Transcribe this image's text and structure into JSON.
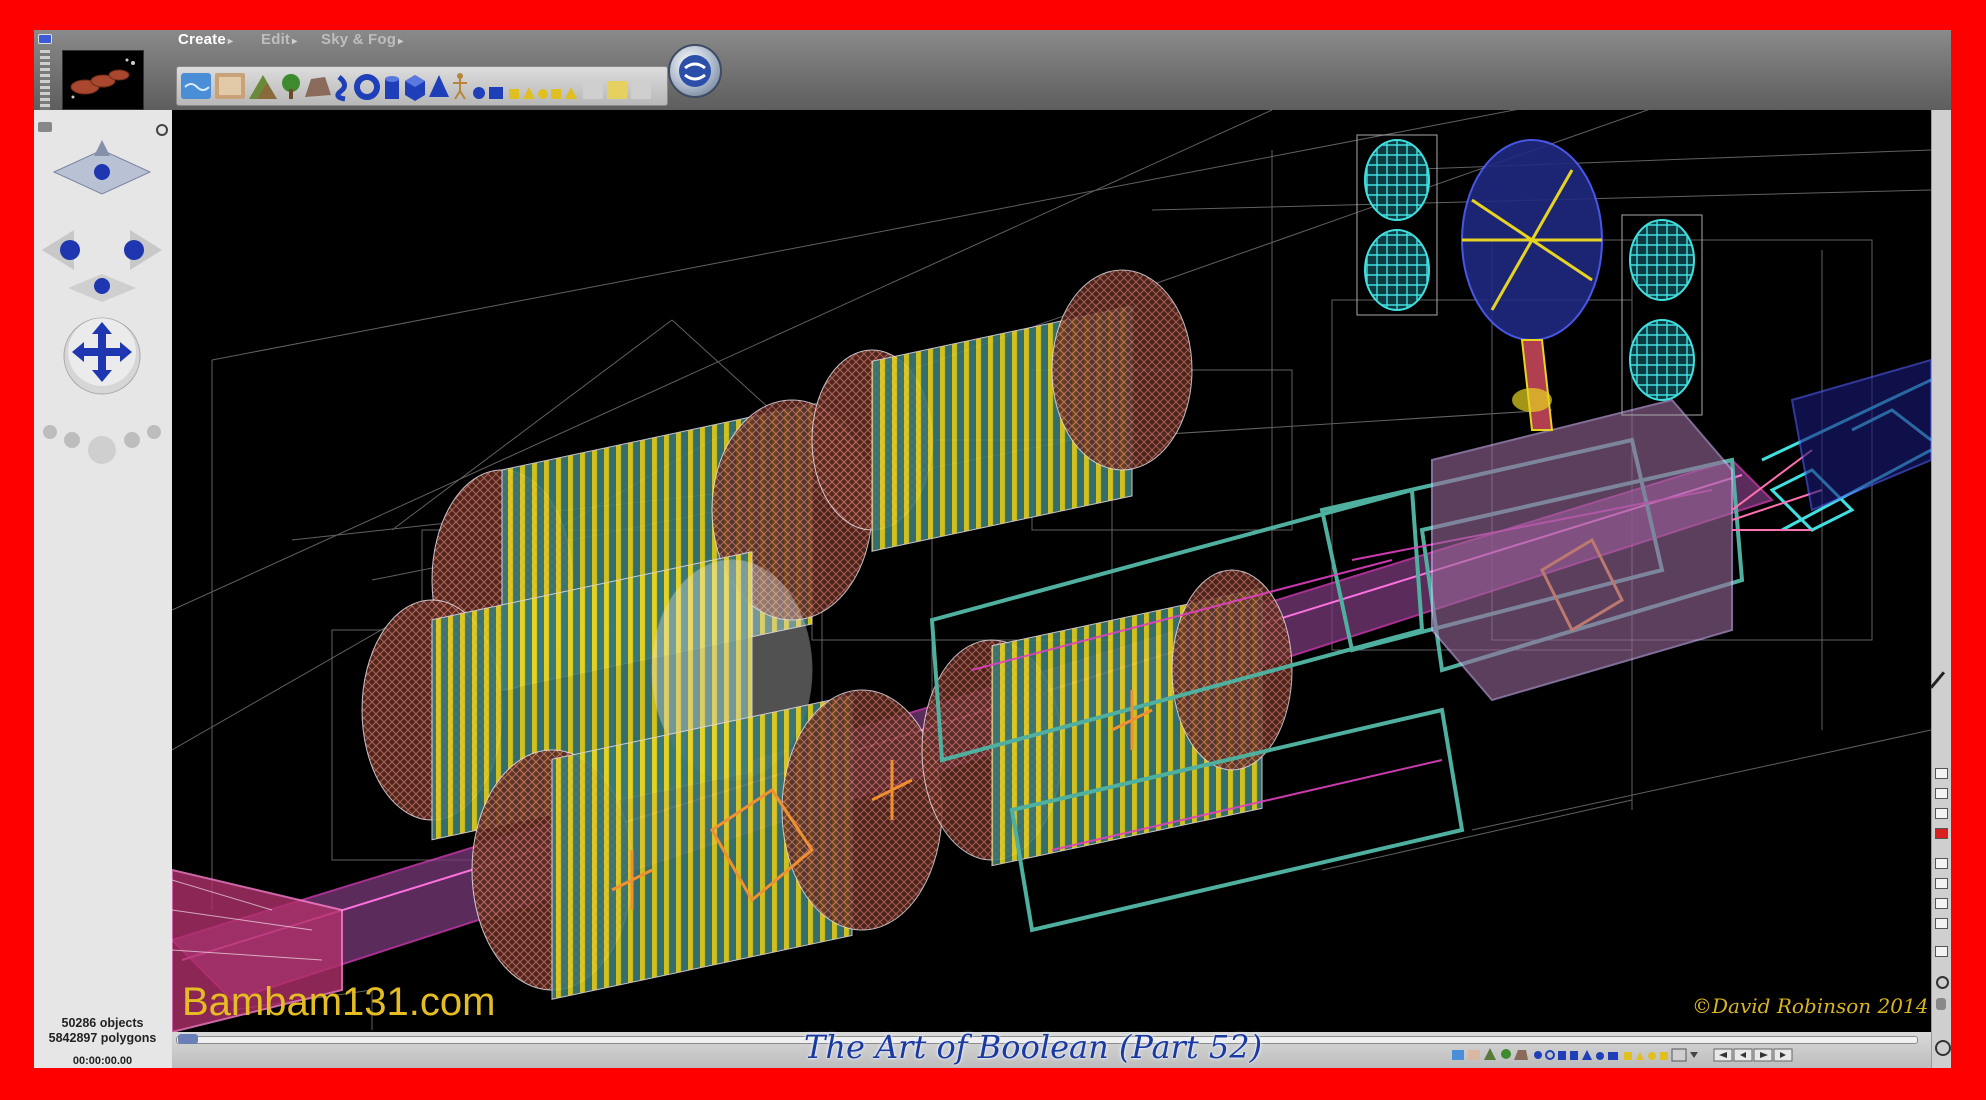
{
  "menubar": {
    "create": "Create",
    "edit": "Edit",
    "sky_fog": "Sky & Fog"
  },
  "icons": {
    "render": "render-sphere-icon",
    "zoom": "zoom-icon",
    "hand": "hand-icon"
  },
  "status": {
    "objects": "50286 objects",
    "polygons": "5842897 polygons",
    "time": "00:00:00.00"
  },
  "overlay": {
    "watermark": "Bambam131.com",
    "signature": "©David Robinson 2014",
    "caption": "The Art of Boolean (Part 52)"
  },
  "colors": {
    "frame": "#ff0000",
    "wireframe_yellow": "#e8d420",
    "wireframe_teal": "#4fb0a0",
    "wireframe_pink": "#e040c0",
    "wireframe_cyan": "#40e0e0",
    "wireframe_blue": "#5060ff",
    "wireframe_brown": "#c06050",
    "caption_blue": "#1a3aa0"
  }
}
